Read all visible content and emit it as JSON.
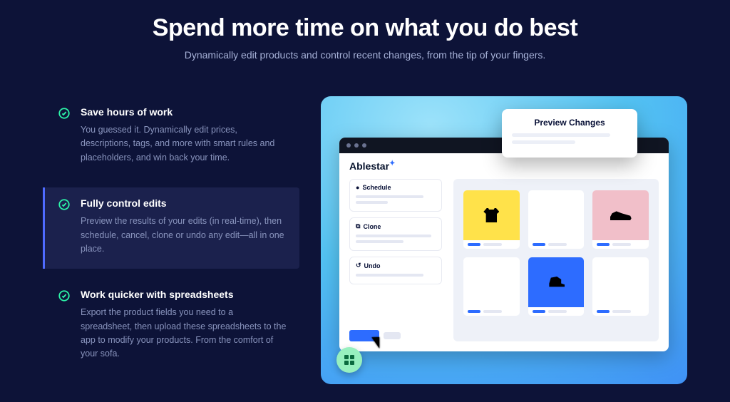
{
  "hero": {
    "title": "Spend more time on what you do best",
    "subtitle": "Dynamically edit products and control recent changes, from the tip of your fingers."
  },
  "features": [
    {
      "title": "Save hours of work",
      "body": "You guessed it. Dynamically edit prices, descriptions, tags, and more with smart rules and placeholders, and win back your time."
    },
    {
      "title": "Fully control edits",
      "body": "Preview the results of your edits (in real-time), then schedule, cancel, clone or undo any edit—all in one place."
    },
    {
      "title": "Work quicker with spreadsheets",
      "body": "Export the product fields you need to a spreadsheet, then upload these spreadsheets to the app to modify your products. From the comfort of your sofa."
    }
  ],
  "mock": {
    "brand": "Ablestar",
    "preview_title": "Preview Changes",
    "side_items": [
      {
        "icon": "●",
        "label": "Schedule"
      },
      {
        "icon": "⧉",
        "label": "Clone"
      },
      {
        "icon": "↺",
        "label": "Undo"
      }
    ]
  },
  "colors": {
    "accent": "#2d6cff",
    "fab": "#97f0bf"
  }
}
